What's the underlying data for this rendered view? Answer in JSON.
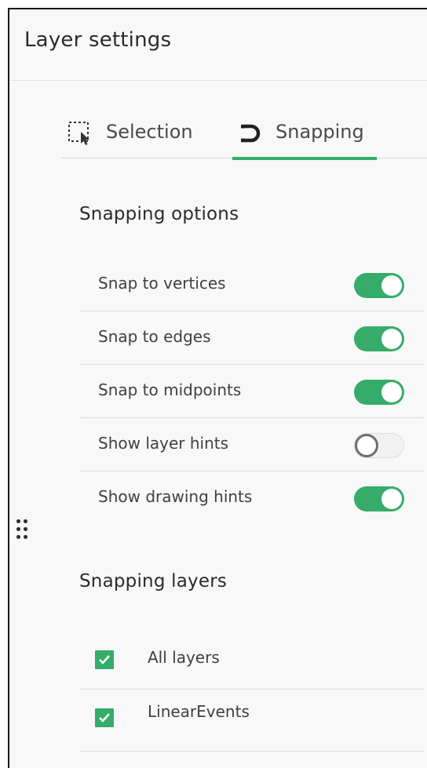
{
  "header": {
    "title": "Layer settings"
  },
  "tabs": [
    {
      "label": "Selection",
      "icon": "selection-cursor-icon",
      "active": false
    },
    {
      "label": "Snapping",
      "icon": "magnet-icon",
      "active": true
    }
  ],
  "snapping_options": {
    "heading": "Snapping options",
    "items": [
      {
        "label": "Snap to vertices",
        "enabled": true
      },
      {
        "label": "Snap to edges",
        "enabled": true
      },
      {
        "label": "Snap to midpoints",
        "enabled": true
      },
      {
        "label": "Show layer hints",
        "enabled": false
      },
      {
        "label": "Show drawing hints",
        "enabled": true
      }
    ]
  },
  "snapping_layers": {
    "heading": "Snapping layers",
    "items": [
      {
        "label": "All layers",
        "checked": true
      },
      {
        "label": "LinearEvents",
        "checked": true
      }
    ]
  },
  "colors": {
    "accent": "#35ac6a",
    "panel_background": "#f8f8f8",
    "divider": "#dcdcdc"
  }
}
